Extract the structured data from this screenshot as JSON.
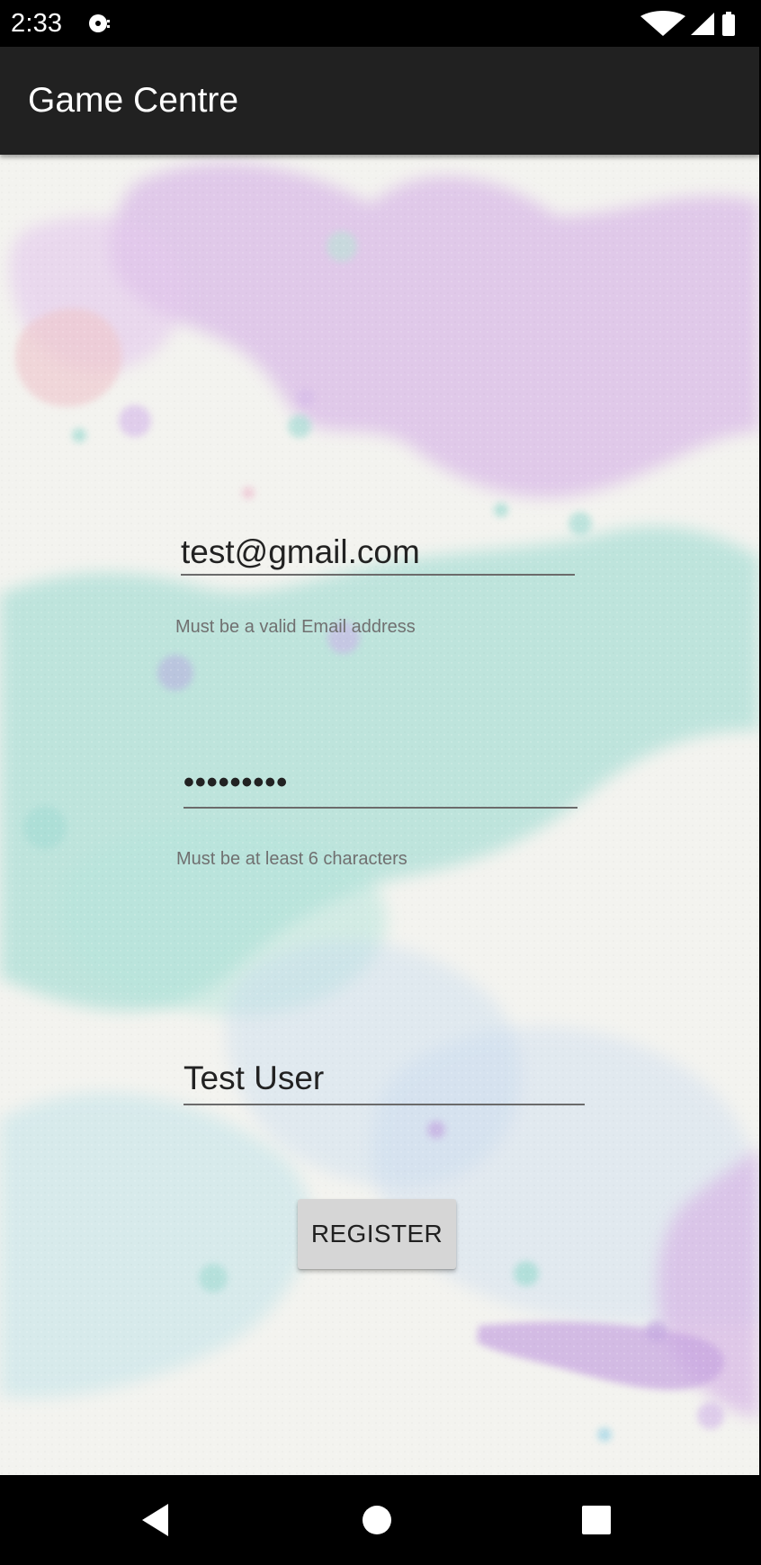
{
  "status_bar": {
    "time": "2:33",
    "notification_icon": "disk-notification-icon",
    "wifi_icon": "wifi-icon",
    "signal_icon": "cell-signal-icon",
    "battery_icon": "battery-icon"
  },
  "app_bar": {
    "title": "Game Centre"
  },
  "form": {
    "email": {
      "value": "test@gmail.com",
      "helper": "Must be a valid Email address"
    },
    "password": {
      "value": "•••••••••",
      "helper": "Must be at least 6 characters"
    },
    "name": {
      "value": "Test User"
    },
    "register_label": "REGISTER"
  },
  "navigation": {
    "back_icon": "back-triangle-icon",
    "home_icon": "home-circle-icon",
    "recents_icon": "recents-square-icon"
  },
  "colors": {
    "app_bar": "#212121",
    "background": "#f4f4f1",
    "button": "#d6d6d6"
  }
}
